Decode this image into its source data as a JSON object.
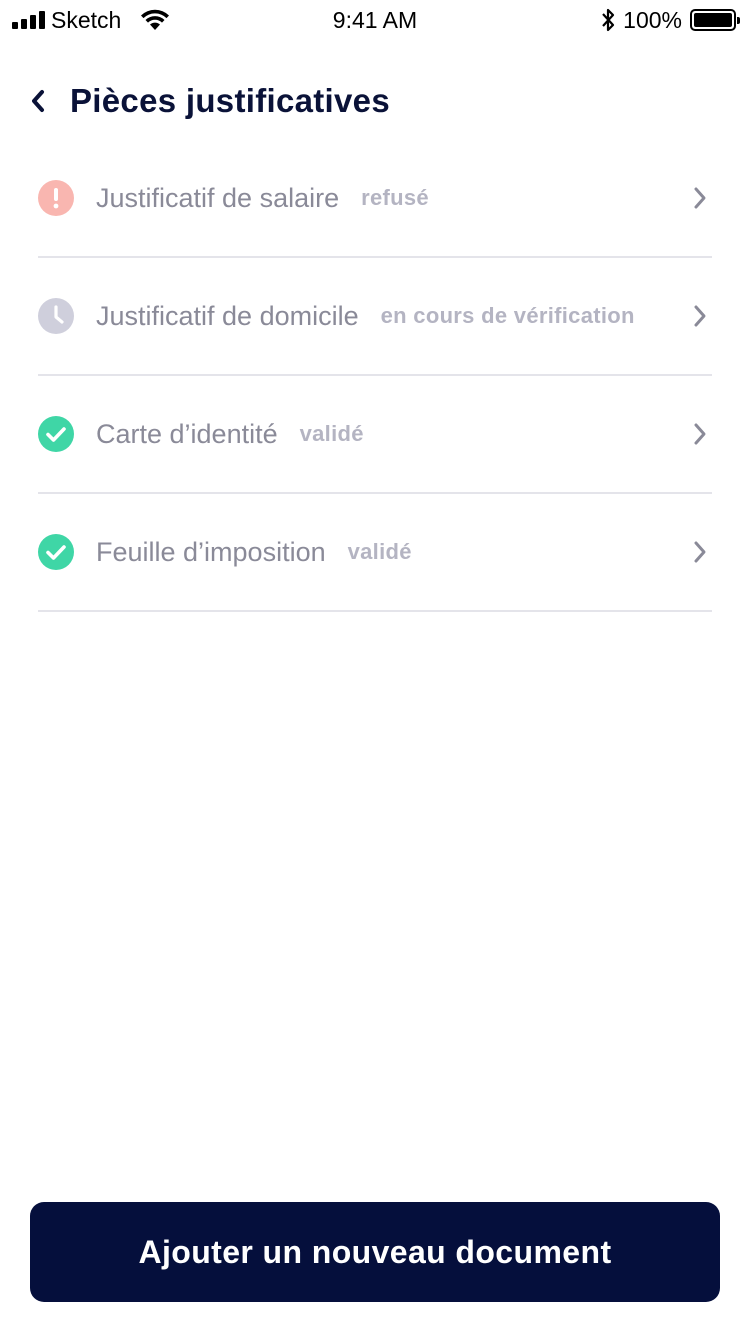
{
  "status_bar": {
    "carrier": "Sketch",
    "time": "9:41 AM",
    "battery": "100%"
  },
  "header": {
    "title": "Pièces justificatives",
    "back_icon": "chevron-left-icon"
  },
  "documents": [
    {
      "name": "Justificatif de salaire",
      "status": "refusé",
      "state": "refused",
      "icon": "alert-icon",
      "icon_color": "#f9b6b0"
    },
    {
      "name": "Justificatif de domicile",
      "status": "en cours de vérification",
      "state": "pending",
      "icon": "clock-icon",
      "icon_color": "#cfcfdc"
    },
    {
      "name": "Carte d’identité",
      "status": "validé",
      "state": "validated",
      "icon": "check-icon",
      "icon_color": "#3fd6a6"
    },
    {
      "name": "Feuille d’imposition",
      "status": "validé",
      "state": "validated",
      "icon": "check-icon",
      "icon_color": "#3fd6a6"
    }
  ],
  "add_button": {
    "label": "Ajouter un nouveau document"
  },
  "colors": {
    "primary": "#050f3c",
    "refused": "#f9b6b0",
    "pending": "#cfcfdc",
    "validated": "#3fd6a6"
  }
}
